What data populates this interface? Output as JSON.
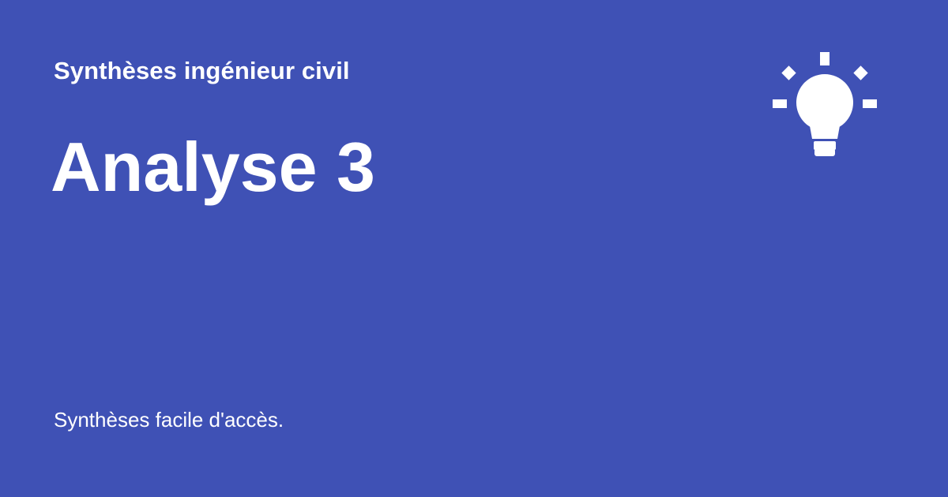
{
  "header": {
    "site_name": "Synthèses ingénieur civil"
  },
  "main": {
    "title": "Analyse 3"
  },
  "footer": {
    "tagline": "Synthèses facile d'accès."
  },
  "logo": {
    "icon": "lightbulb-icon"
  },
  "colors": {
    "background": "#3f51b5",
    "text": "#ffffff"
  }
}
